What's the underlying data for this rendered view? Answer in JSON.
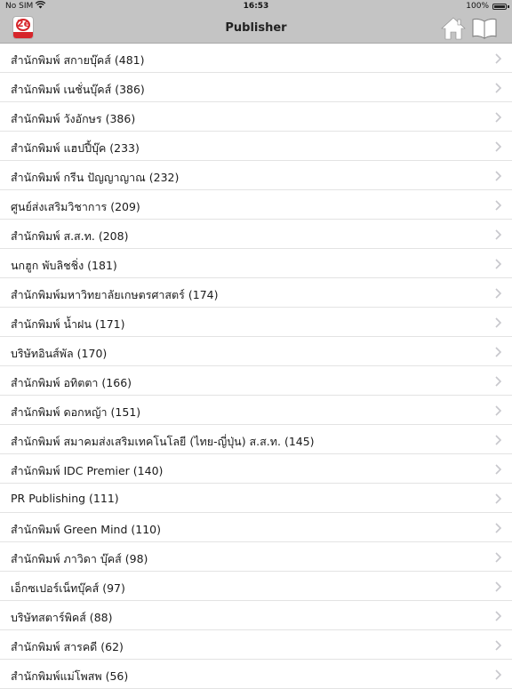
{
  "status_bar": {
    "carrier": "No SIM",
    "time": "16:53",
    "battery": "100%"
  },
  "nav": {
    "title": "Publisher",
    "logo_text": "2e",
    "icons": [
      "app-logo",
      "home-icon",
      "book-icon"
    ]
  },
  "publishers": [
    {
      "label": "สำนักพิมพ์ สกายบุ๊คส์ (481)"
    },
    {
      "label": "สำนักพิมพ์ เนชั่นบุ๊คส์ (386)"
    },
    {
      "label": "สำนักพิมพ์ วังอักษร (386)"
    },
    {
      "label": "สำนักพิมพ์ แฮปปี้บุ๊ค (233)"
    },
    {
      "label": "สำนักพิมพ์ กรีน ปัญญาญาณ (232)"
    },
    {
      "label": "ศูนย์ส่งเสริมวิชาการ (209)"
    },
    {
      "label": "สำนักพิมพ์ ส.ส.ท. (208)"
    },
    {
      "label": "นกฮูก พับลิชชิ่ง (181)"
    },
    {
      "label": "สำนักพิมพ์มหาวิทยาลัยเกษตรศาสตร์ (174)"
    },
    {
      "label": "สำนักพิมพ์ น้ำฝน (171)"
    },
    {
      "label": "บริษัทอินส์พัล (170)"
    },
    {
      "label": "สำนักพิมพ์ อทิตตา (166)"
    },
    {
      "label": "สำนักพิมพ์ ดอกหญ้า (151)"
    },
    {
      "label": "สำนักพิมพ์ สมาคมส่งเสริมเทคโนโลยี (ไทย-ญี่ปุ่น) ส.ส.ท. (145)"
    },
    {
      "label": "สำนักพิมพ์ IDC Premier (140)"
    },
    {
      "label": "PR Publishing (111)"
    },
    {
      "label": "สำนักพิมพ์ Green Mind (110)"
    },
    {
      "label": "สำนักพิมพ์ ภาวิดา บุ๊คส์ (98)"
    },
    {
      "label": "เอ็กซเปอร์เน็ทบุ๊คส์ (97)"
    },
    {
      "label": "บริษัทสตาร์พิคส์ (88)"
    },
    {
      "label": "สำนักพิมพ์ สารคดี (62)"
    },
    {
      "label": "สำนักพิมพ์แม่โพสพ (56)"
    }
  ]
}
